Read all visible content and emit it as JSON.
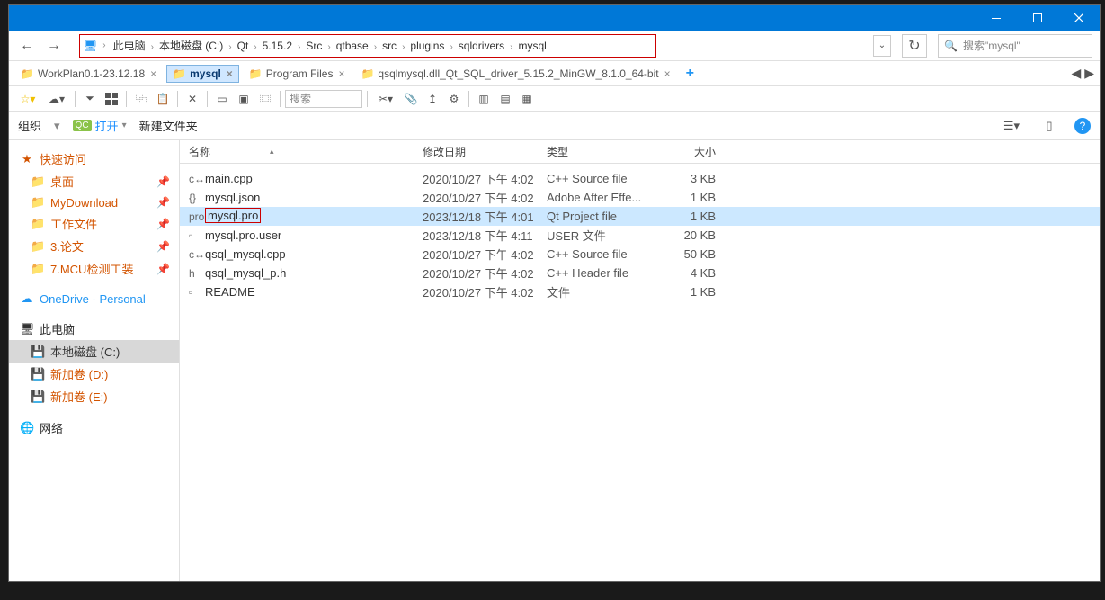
{
  "breadcrumb": [
    "此电脑",
    "本地磁盘 (C:)",
    "Qt",
    "5.15.2",
    "Src",
    "qtbase",
    "src",
    "plugins",
    "sqldrivers",
    "mysql"
  ],
  "search_placeholder": "搜索\"mysql\"",
  "tabs": [
    {
      "label": "WorkPlan0.1-23.12.18",
      "active": false
    },
    {
      "label": "mysql",
      "active": true
    },
    {
      "label": "Program Files",
      "active": false
    },
    {
      "label": "qsqlmysql.dll_Qt_SQL_driver_5.15.2_MinGW_8.1.0_64-bit",
      "active": false
    }
  ],
  "toolbar_search_placeholder": "搜索",
  "cmdbar": {
    "org": "组织",
    "open": "打开",
    "newfolder": "新建文件夹"
  },
  "sidebar": {
    "quick": {
      "title": "快速访问",
      "items": [
        "桌面",
        "MyDownload",
        "工作文件",
        "3.论文",
        "7.MCU检测工装"
      ]
    },
    "onedrive": "OneDrive - Personal",
    "pc": {
      "title": "此电脑",
      "items": [
        "本地磁盘 (C:)",
        "新加卷 (D:)",
        "新加卷 (E:)"
      ]
    },
    "network": "网络"
  },
  "columns": {
    "name": "名称",
    "date": "修改日期",
    "type": "类型",
    "size": "大小"
  },
  "files": [
    {
      "icon": "cpp",
      "name": "main.cpp",
      "date": "2020/10/27 下午 4:02",
      "type": "C++ Source file",
      "size": "3 KB",
      "sel": false
    },
    {
      "icon": "json",
      "name": "mysql.json",
      "date": "2020/10/27 下午 4:02",
      "type": "Adobe After Effe...",
      "size": "1 KB",
      "sel": false
    },
    {
      "icon": "pro",
      "name": "mysql.pro",
      "date": "2023/12/18 下午 4:01",
      "type": "Qt Project file",
      "size": "1 KB",
      "sel": true,
      "boxed": true
    },
    {
      "icon": "file",
      "name": "mysql.pro.user",
      "date": "2023/12/18 下午 4:11",
      "type": "USER 文件",
      "size": "20 KB",
      "sel": false
    },
    {
      "icon": "cpp",
      "name": "qsql_mysql.cpp",
      "date": "2020/10/27 下午 4:02",
      "type": "C++ Source file",
      "size": "50 KB",
      "sel": false
    },
    {
      "icon": "h",
      "name": "qsql_mysql_p.h",
      "date": "2020/10/27 下午 4:02",
      "type": "C++ Header file",
      "size": "4 KB",
      "sel": false
    },
    {
      "icon": "file",
      "name": "README",
      "date": "2020/10/27 下午 4:02",
      "type": "文件",
      "size": "1 KB",
      "sel": false
    }
  ]
}
